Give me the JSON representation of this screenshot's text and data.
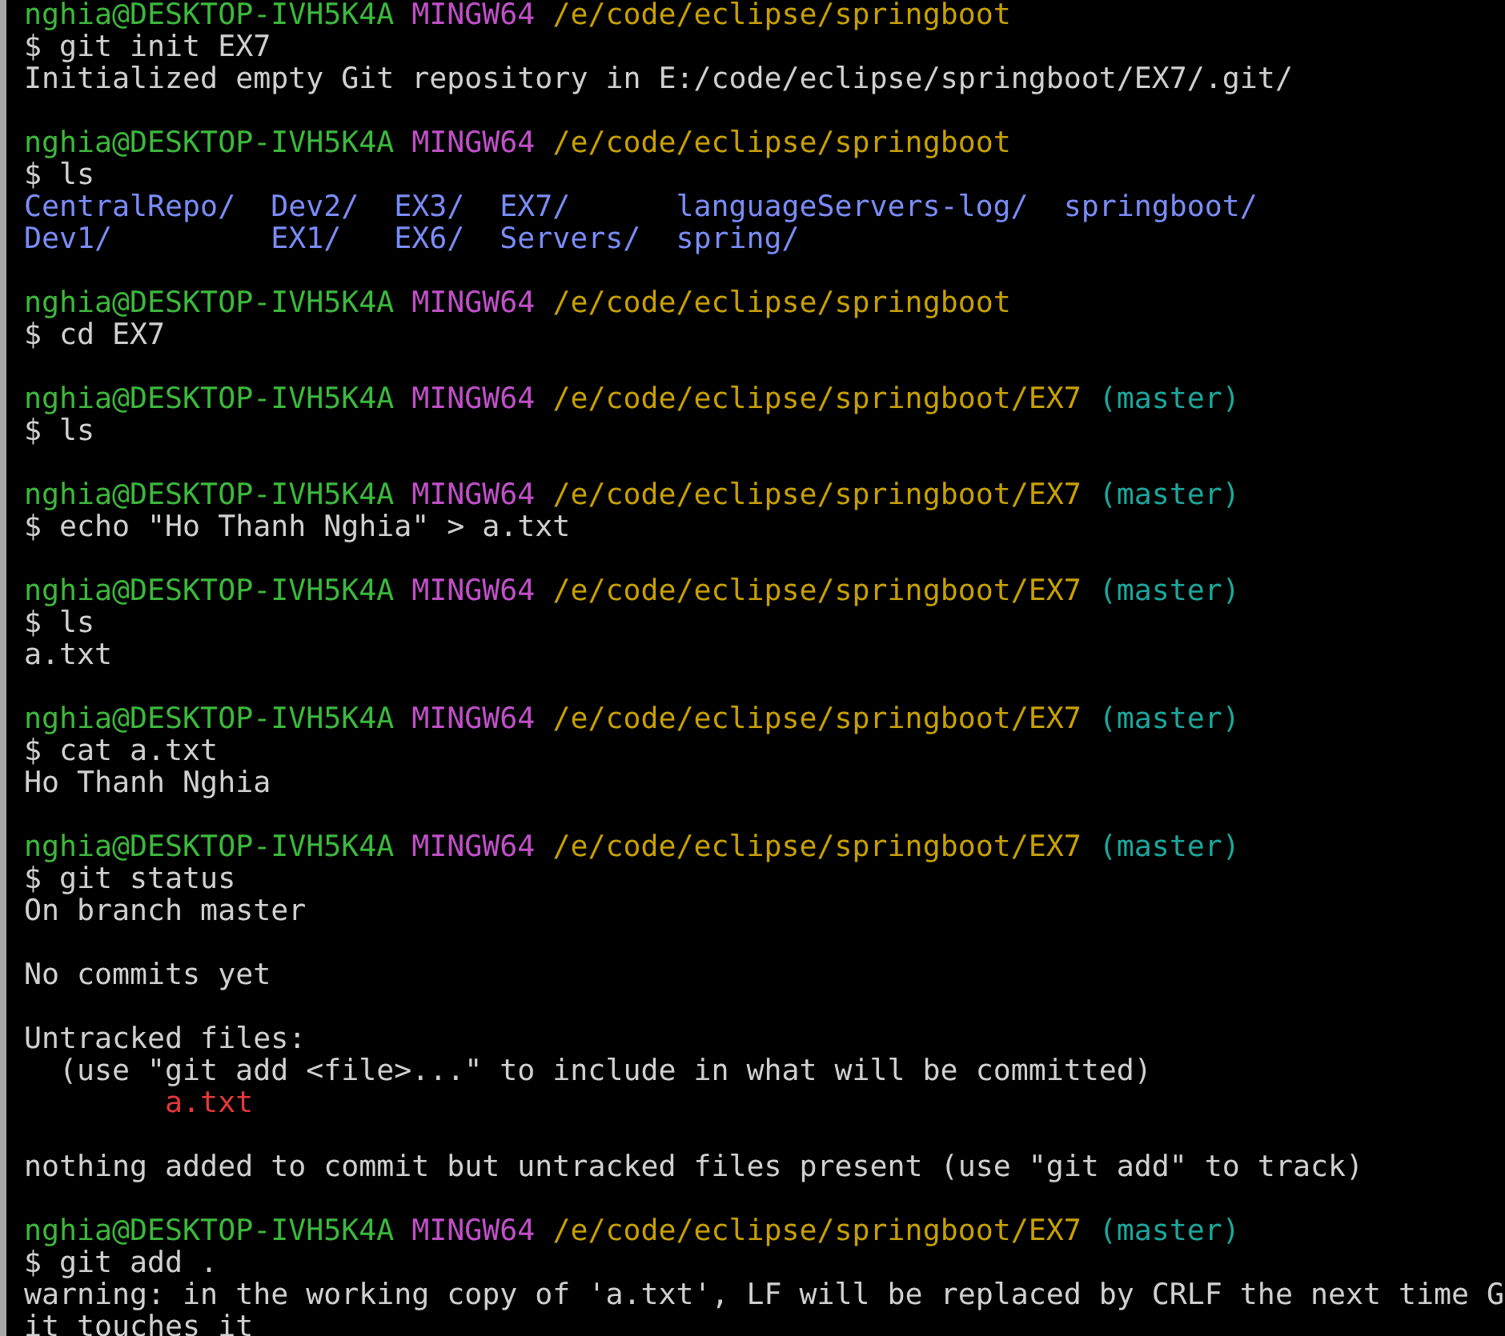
{
  "lines": [
    {
      "kind": "prompt",
      "user": "nghia@DESKTOP-IVH5K4A",
      "system": "MINGW64",
      "path": "/e/code/eclipse/springboot"
    },
    {
      "kind": "command",
      "text": "$ git init EX7"
    },
    {
      "kind": "output",
      "text": "Initialized empty Git repository in E:/code/eclipse/springboot/EX7/.git/"
    },
    {
      "kind": "blank"
    },
    {
      "kind": "prompt",
      "user": "nghia@DESKTOP-IVH5K4A",
      "system": "MINGW64",
      "path": "/e/code/eclipse/springboot"
    },
    {
      "kind": "command",
      "text": "$ ls"
    },
    {
      "kind": "columns",
      "entries": [
        "CentralRepo/",
        "Dev2/",
        "EX3/",
        "EX7/",
        "languageServers-log/",
        "springboot/"
      ]
    },
    {
      "kind": "columns",
      "entries": [
        "Dev1/",
        "EX1/",
        "EX6/",
        "Servers/",
        "spring/"
      ]
    },
    {
      "kind": "blank"
    },
    {
      "kind": "prompt",
      "user": "nghia@DESKTOP-IVH5K4A",
      "system": "MINGW64",
      "path": "/e/code/eclipse/springboot"
    },
    {
      "kind": "command",
      "text": "$ cd EX7"
    },
    {
      "kind": "blank"
    },
    {
      "kind": "prompt",
      "user": "nghia@DESKTOP-IVH5K4A",
      "system": "MINGW64",
      "path": "/e/code/eclipse/springboot/EX7",
      "branch": "(master)"
    },
    {
      "kind": "command",
      "text": "$ ls"
    },
    {
      "kind": "blank"
    },
    {
      "kind": "prompt",
      "user": "nghia@DESKTOP-IVH5K4A",
      "system": "MINGW64",
      "path": "/e/code/eclipse/springboot/EX7",
      "branch": "(master)"
    },
    {
      "kind": "command",
      "text": "$ echo \"Ho Thanh Nghia\" > a.txt"
    },
    {
      "kind": "blank"
    },
    {
      "kind": "prompt",
      "user": "nghia@DESKTOP-IVH5K4A",
      "system": "MINGW64",
      "path": "/e/code/eclipse/springboot/EX7",
      "branch": "(master)"
    },
    {
      "kind": "command",
      "text": "$ ls"
    },
    {
      "kind": "output",
      "text": "a.txt"
    },
    {
      "kind": "blank"
    },
    {
      "kind": "prompt",
      "user": "nghia@DESKTOP-IVH5K4A",
      "system": "MINGW64",
      "path": "/e/code/eclipse/springboot/EX7",
      "branch": "(master)"
    },
    {
      "kind": "command",
      "text": "$ cat a.txt"
    },
    {
      "kind": "output",
      "text": "Ho Thanh Nghia"
    },
    {
      "kind": "blank"
    },
    {
      "kind": "prompt",
      "user": "nghia@DESKTOP-IVH5K4A",
      "system": "MINGW64",
      "path": "/e/code/eclipse/springboot/EX7",
      "branch": "(master)"
    },
    {
      "kind": "command",
      "text": "$ git status"
    },
    {
      "kind": "output",
      "text": "On branch master"
    },
    {
      "kind": "blank"
    },
    {
      "kind": "output",
      "text": "No commits yet"
    },
    {
      "kind": "blank"
    },
    {
      "kind": "output",
      "text": "Untracked files:"
    },
    {
      "kind": "hint",
      "text": "(use \"git add <file>...\" to include in what will be committed)"
    },
    {
      "kind": "untracked",
      "text": "a.txt"
    },
    {
      "kind": "blank"
    },
    {
      "kind": "output",
      "text": "nothing added to commit but untracked files present (use \"git add\" to track)"
    },
    {
      "kind": "blank"
    },
    {
      "kind": "prompt",
      "user": "nghia@DESKTOP-IVH5K4A",
      "system": "MINGW64",
      "path": "/e/code/eclipse/springboot/EX7",
      "branch": "(master)"
    },
    {
      "kind": "command",
      "text": "$ git add ."
    },
    {
      "kind": "output",
      "text": "warning: in the working copy of 'a.txt', LF will be replaced by CRLF the next time G"
    },
    {
      "kind": "output",
      "text": "it touches it"
    }
  ]
}
